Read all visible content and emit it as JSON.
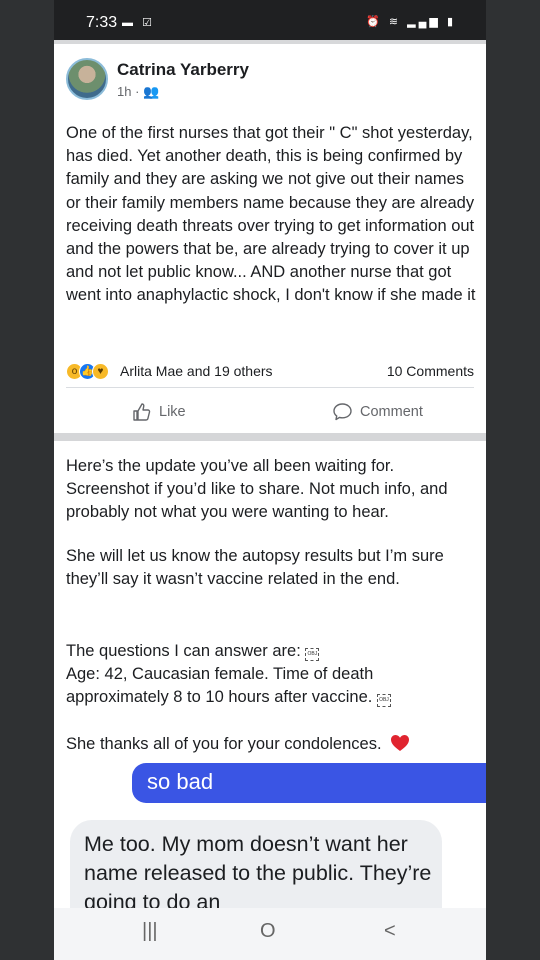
{
  "status": {
    "time": "7:33",
    "left_icons": [
      "mail-icon",
      "check-icon"
    ],
    "right_icons": [
      "alarm-icon",
      "wifi-icon",
      "signal-icon",
      "battery-icon"
    ]
  },
  "post": {
    "author": "Catrina Yarberry",
    "time": "1h",
    "audience_icon": "friends-icon",
    "text": "One of the first nurses that got their \" C\" shot yesterday, has died.  Yet another death,  this is being confirmed by family and they are asking we not give out their names or their family members name because they are already receiving death threats over trying to get information out and the powers that be, are already trying to cover it up and not let public know... AND another nurse that got went into anaphylactic shock,  I don't know if she made it",
    "reactions": {
      "icons": [
        "wow-icon",
        "like-icon",
        "care-icon"
      ],
      "names": "Arlita Mae and 19 others",
      "comments": "10 Comments"
    },
    "actions": {
      "like": "Like",
      "comment": "Comment"
    }
  },
  "shared_screenshot": {
    "paragraph1": "Here’s the update you’ve all been waiting for. Screenshot if you’d like to share. Not much info, and probably not what you were wanting to hear.",
    "paragraph2": "She will let us know the autopsy results but I’m sure they’ll say it wasn’t vaccine related in the end.",
    "paragraph3_line1": "The questions I can answer are:",
    "paragraph3_line2": "Age: 42, Caucasian female. Time of death approximately 8 to 10 hours after vaccine.",
    "obj_label": "OBJ",
    "paragraph4": "She thanks all of you for your condolences.",
    "sent_message": "so bad",
    "received_message": "Me too. My mom doesn’t want her name released to the public. They’re going to do an"
  },
  "nav": {
    "recents": "|||",
    "home": "O",
    "back": "<"
  },
  "colors": {
    "facebook_blue": "#1877f2",
    "message_blue": "#3a55e4",
    "heart_red": "#e0242f"
  }
}
